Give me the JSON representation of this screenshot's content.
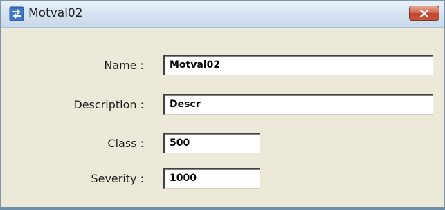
{
  "window": {
    "title": "Motval02",
    "close_icon": "close-icon",
    "app_icon": "transfer-arrows-icon"
  },
  "form": {
    "name": {
      "label": "Name :",
      "value": "Motval02"
    },
    "description": {
      "label": "Description :",
      "value": "Descr"
    },
    "class": {
      "label": "Class :",
      "value": "500"
    },
    "severity": {
      "label": "Severity :",
      "value": "1000"
    }
  },
  "colors": {
    "titlebar": "#d7e4f1",
    "body": "#ece9d8",
    "close_button": "#c8543a"
  }
}
